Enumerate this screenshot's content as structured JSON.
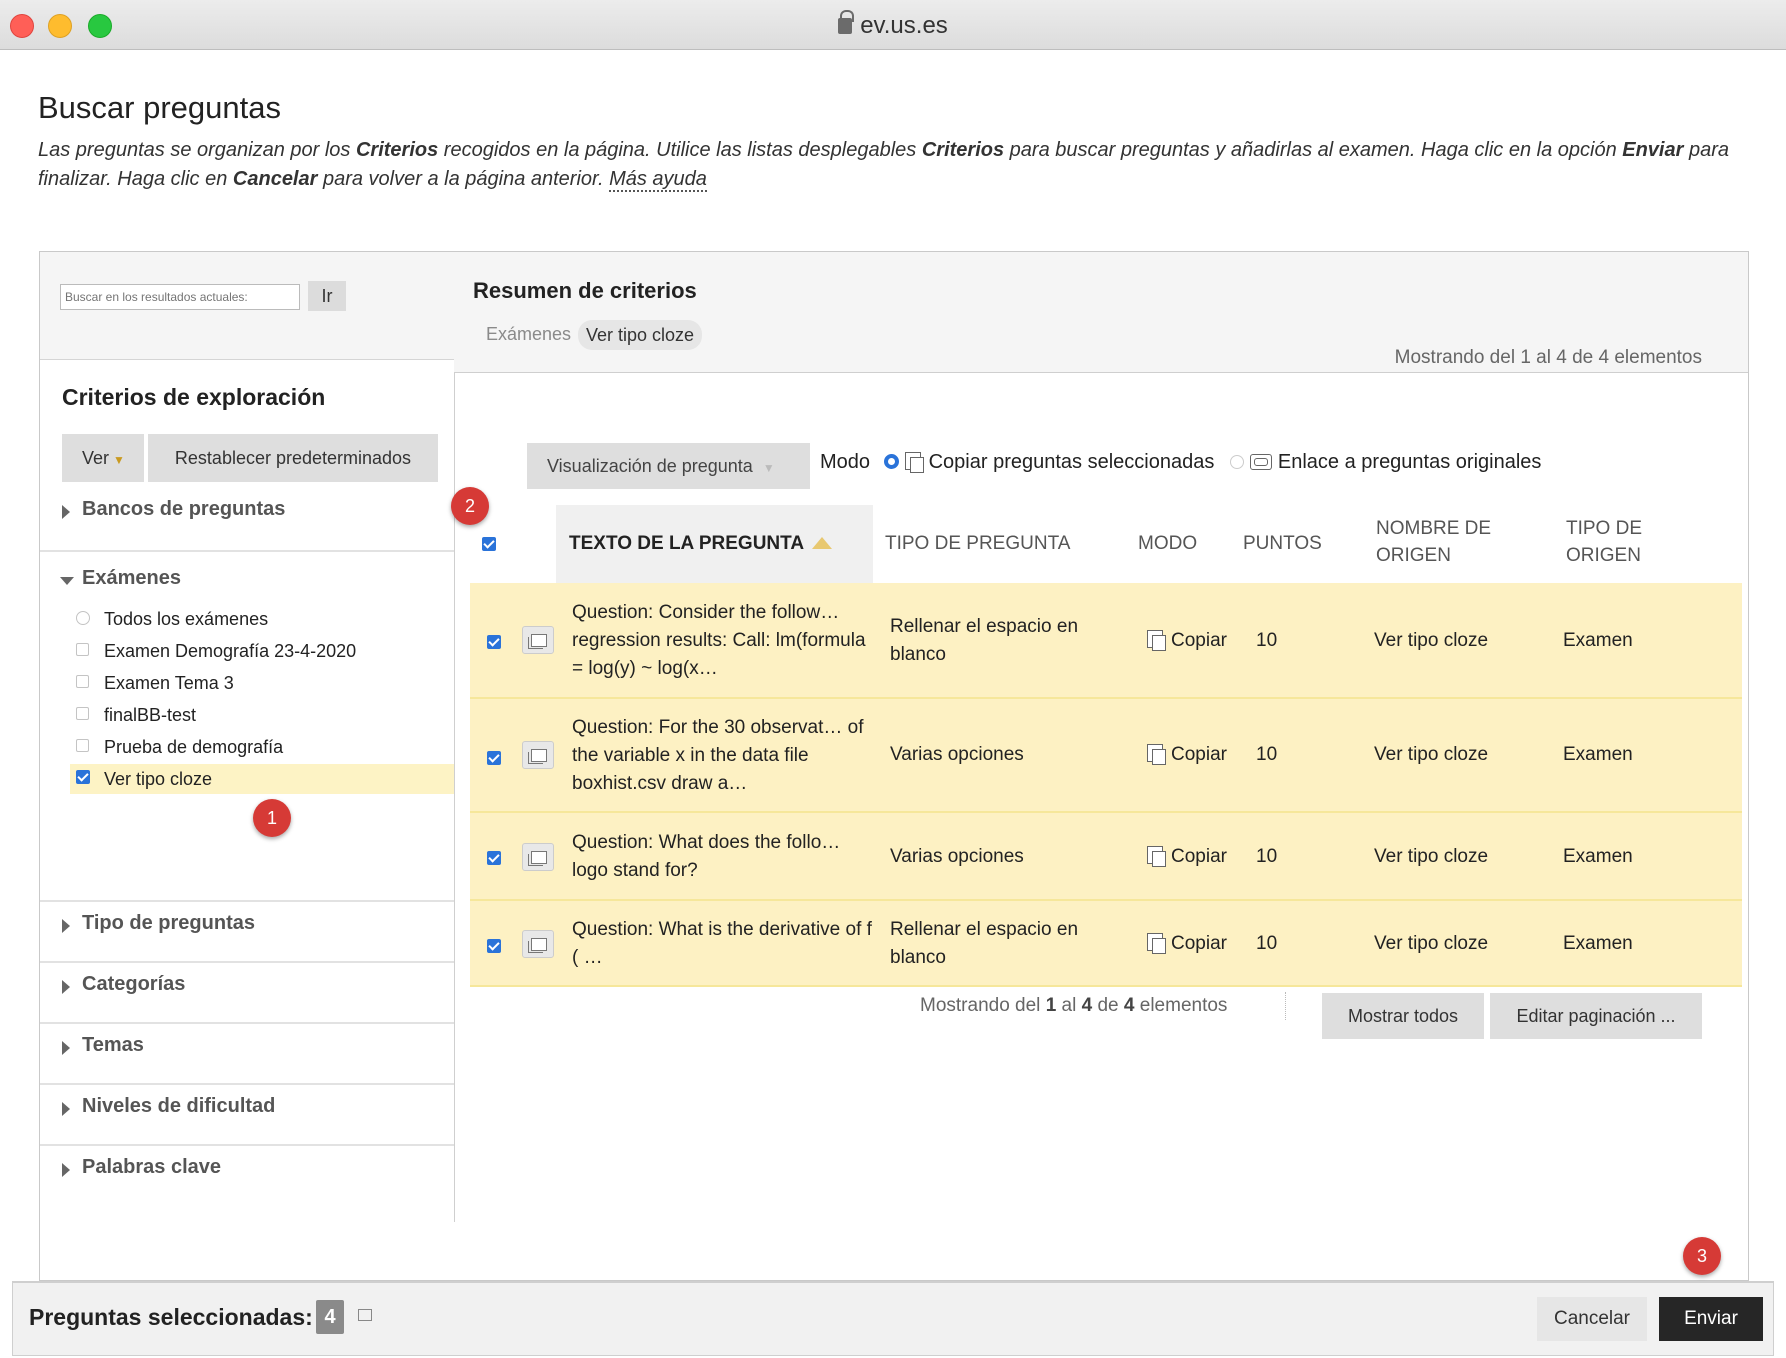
{
  "window": {
    "url": "ev.us.es"
  },
  "page": {
    "title": "Buscar preguntas",
    "intro": {
      "p1": "Las preguntas se organizan por los ",
      "b1": "Criterios",
      "p2": " recogidos en la página. Utilice las listas desplegables ",
      "b2": "Criterios",
      "p3": " para buscar preguntas y añadirlas al examen. Haga clic en la opción ",
      "b3": "Enviar",
      "p4": " para finalizar. Haga clic en ",
      "b4": "Cancelar",
      "p5": " para volver a la página anterior. ",
      "help_link": "Más ayuda"
    }
  },
  "search": {
    "placeholder": "Buscar en los resultados actuales:",
    "go_label": "Ir"
  },
  "summary": {
    "title": "Resumen de criterios",
    "label": "Exámenes",
    "chip": "Ver tipo cloze"
  },
  "sidebar": {
    "title": "Criterios de exploración",
    "ver_label": "Ver",
    "reset_label": "Restablecer predeterminados",
    "sections": {
      "bancos": "Bancos de preguntas",
      "examenes": "Exámenes",
      "tipo": "Tipo de preguntas",
      "categorias": "Categorías",
      "temas": "Temas",
      "niveles": "Niveles de dificultad",
      "palabras": "Palabras clave"
    },
    "exams": [
      {
        "label": "Todos los exámenes",
        "type": "radio",
        "checked": false
      },
      {
        "label": "Examen Demografía 23-4-2020",
        "type": "checkbox",
        "checked": false
      },
      {
        "label": "Examen Tema 3",
        "type": "checkbox",
        "checked": false
      },
      {
        "label": "finalBB-test",
        "type": "checkbox",
        "checked": false
      },
      {
        "label": "Prueba de demografía",
        "type": "checkbox",
        "checked": false
      },
      {
        "label": "Ver tipo cloze",
        "type": "checkbox",
        "checked": true
      }
    ]
  },
  "markers": {
    "m1": "1",
    "m2": "2",
    "m3": "3"
  },
  "results": {
    "showing_top": "Mostrando del 1 al 4 de 4 elementos",
    "vis_label": "Visualización de pregunta",
    "mode_label": "Modo",
    "mode_copy": "Copiar preguntas seleccionadas",
    "mode_link": "Enlace a preguntas originales",
    "columns": {
      "text": "TEXTO DE LA PREGUNTA",
      "type": "TIPO DE PREGUNTA",
      "mode": "MODO",
      "points": "PUNTOS",
      "origin_name": "NOMBRE DE ORIGEN",
      "origin_type": "TIPO DE ORIGEN"
    },
    "rows": [
      {
        "text": "Question: Consider the follow… regression results: Call: lm(formula = log(y) ~ log(x…",
        "type": "Rellenar el espacio en blanco",
        "mode": "Copiar",
        "points": "10",
        "origin_name": "Ver tipo cloze",
        "origin_type": "Examen"
      },
      {
        "text": "Question: For the 30 observat… of the variable x in the data file boxhist.csv draw a…",
        "type": "Varias opciones",
        "mode": "Copiar",
        "points": "10",
        "origin_name": "Ver tipo cloze",
        "origin_type": "Examen"
      },
      {
        "text": "Question: What does the follo… logo stand for?",
        "type": "Varias opciones",
        "mode": "Copiar",
        "points": "10",
        "origin_name": "Ver tipo cloze",
        "origin_type": "Examen"
      },
      {
        "text": "Question: What is the derivative of f ( …",
        "type": "Rellenar el espacio en blanco",
        "mode": "Copiar",
        "points": "10",
        "origin_name": "Ver tipo cloze",
        "origin_type": "Examen"
      }
    ],
    "pager": {
      "p1": "Mostrando del ",
      "a": "1",
      "p2": " al ",
      "b": "4",
      "p3": " de ",
      "c": "4",
      "p4": " elementos"
    },
    "show_all": "Mostrar todos",
    "edit_paging": "Editar paginación ..."
  },
  "footer": {
    "selected_label": "Preguntas seleccionadas:",
    "selected_count": "4",
    "cancel": "Cancelar",
    "submit": "Enviar"
  },
  "colors": {
    "highlight": "#fdf1c3",
    "accent": "#2a73d9",
    "marker": "#d63a36",
    "submit": "#262626"
  }
}
